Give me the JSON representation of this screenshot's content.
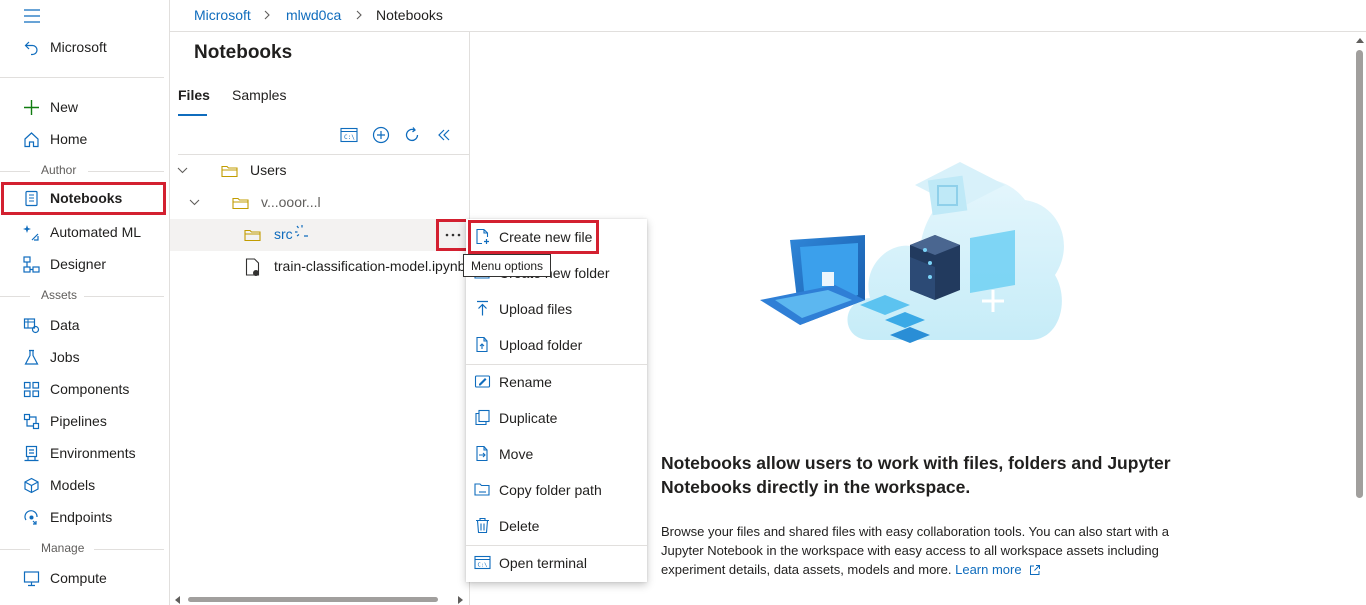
{
  "nav": {
    "back_label": "Microsoft",
    "new_label": "New",
    "home_label": "Home",
    "section_author": "Author",
    "notebooks_label": "Notebooks",
    "automl_label": "Automated ML",
    "designer_label": "Designer",
    "section_assets": "Assets",
    "data_label": "Data",
    "jobs_label": "Jobs",
    "components_label": "Components",
    "pipelines_label": "Pipelines",
    "environments_label": "Environments",
    "models_label": "Models",
    "endpoints_label": "Endpoints",
    "section_manage": "Manage",
    "compute_label": "Compute"
  },
  "breadcrumb": {
    "root": "Microsoft",
    "workspace": "mlwd0ca",
    "current": "Notebooks"
  },
  "panel": {
    "title": "Notebooks",
    "tabs": [
      "Files",
      "Samples"
    ],
    "tree": {
      "users": "Users",
      "user_folder": "v...ooor...l",
      "src": "src",
      "file": "train-classification-model.ipynb"
    }
  },
  "tooltip": "Menu options",
  "menu": {
    "items": [
      "Create new file",
      "Create new folder",
      "Upload files",
      "Upload folder",
      "Rename",
      "Duplicate",
      "Move",
      "Copy folder path",
      "Delete",
      "Open terminal"
    ]
  },
  "main": {
    "heading": "Notebooks allow users to work with files, folders and Jupyter Notebooks directly in the workspace.",
    "description": "Browse your files and shared files with easy collaboration tools. You can also start with a Jupyter Notebook in the workspace with easy access to all workspace assets including experiment details, data assets, models and more.",
    "learn_more": "Learn more"
  },
  "colors": {
    "accent": "#0f6cbd",
    "highlight": "#d32030",
    "selected_row": "#f3f2f1"
  }
}
